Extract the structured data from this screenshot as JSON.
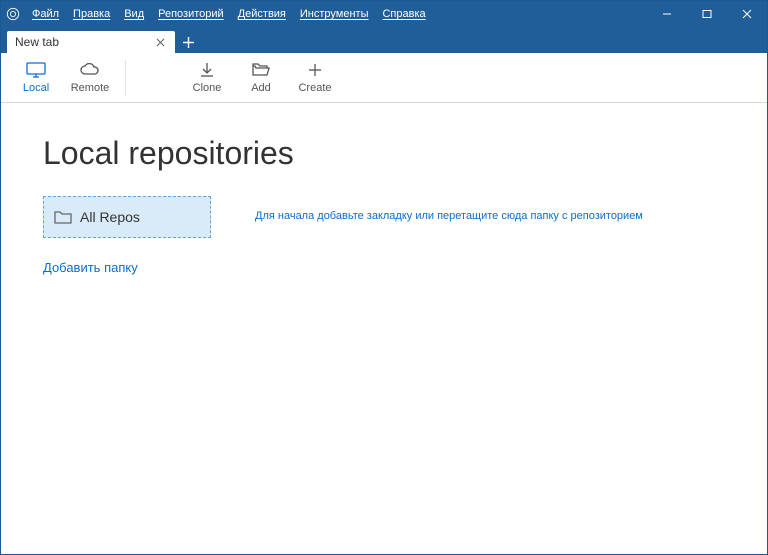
{
  "menu": {
    "file": "Файл",
    "edit": "Правка",
    "view": "Вид",
    "repository": "Репозиторий",
    "actions": "Действия",
    "tools": "Инструменты",
    "help": "Справка"
  },
  "tab": {
    "label": "New tab"
  },
  "toolbar": {
    "local": "Local",
    "remote": "Remote",
    "clone": "Clone",
    "add": "Add",
    "create": "Create"
  },
  "page": {
    "title": "Local repositories"
  },
  "folder": {
    "all_repos": "All Repos",
    "hint": "Для начала добавьте закладку или перетащите сюда папку с репозиторием",
    "add": "Добавить папку"
  }
}
